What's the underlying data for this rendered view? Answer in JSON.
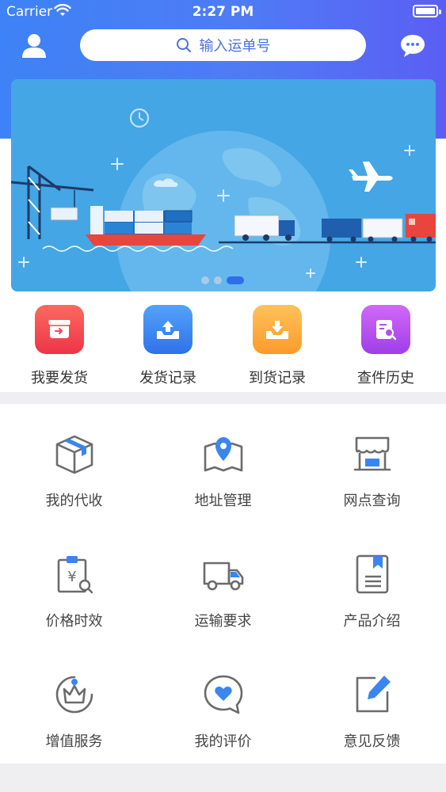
{
  "status_bar": {
    "carrier": "Carrier",
    "time": "2:27 PM"
  },
  "header": {
    "search": {
      "placeholder": "输入运单号"
    },
    "icons": [
      "user-icon",
      "message-icon"
    ]
  },
  "banner": {
    "active_page": 3,
    "pages": 3
  },
  "quick_actions": [
    {
      "label": "我要发货",
      "icon": "ship-box-icon",
      "color": "#f2454f"
    },
    {
      "label": "发货记录",
      "icon": "outbox-upload-icon",
      "color": "#3b82f0"
    },
    {
      "label": "到货记录",
      "icon": "inbox-download-icon",
      "color": "#fba93a"
    },
    {
      "label": "查件历史",
      "icon": "document-search-icon",
      "color": "#b44ef0"
    }
  ],
  "grid": [
    {
      "label": "我的代收",
      "icon": "package-icon"
    },
    {
      "label": "地址管理",
      "icon": "map-pin-icon"
    },
    {
      "label": "网点查询",
      "icon": "storefront-icon"
    },
    {
      "label": "价格时效",
      "icon": "price-clipboard-icon"
    },
    {
      "label": "运输要求",
      "icon": "truck-icon"
    },
    {
      "label": "产品介绍",
      "icon": "book-icon"
    },
    {
      "label": "增值服务",
      "icon": "crown-icon"
    },
    {
      "label": "我的评价",
      "icon": "heart-chat-icon"
    },
    {
      "label": "意见反馈",
      "icon": "edit-icon"
    }
  ],
  "colors": {
    "accent": "#3d82f6",
    "icon_gray": "#6b6b6b",
    "icon_blue": "#3a86ee"
  }
}
